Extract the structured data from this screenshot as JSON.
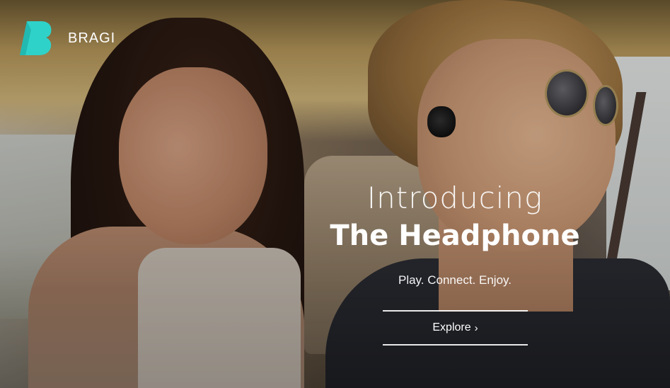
{
  "brand": {
    "name": "BRAGI",
    "mark_color": "#2fd2c9",
    "mark_letter": "B"
  },
  "hero": {
    "intro": "Introducing",
    "product": "The Headphone",
    "tagline": "Play. Connect. Enjoy.",
    "cta_label": "Explore",
    "cta_chevron": "›"
  },
  "theme": {
    "text_color": "#ffffff",
    "accent": "#2fd2c9"
  }
}
